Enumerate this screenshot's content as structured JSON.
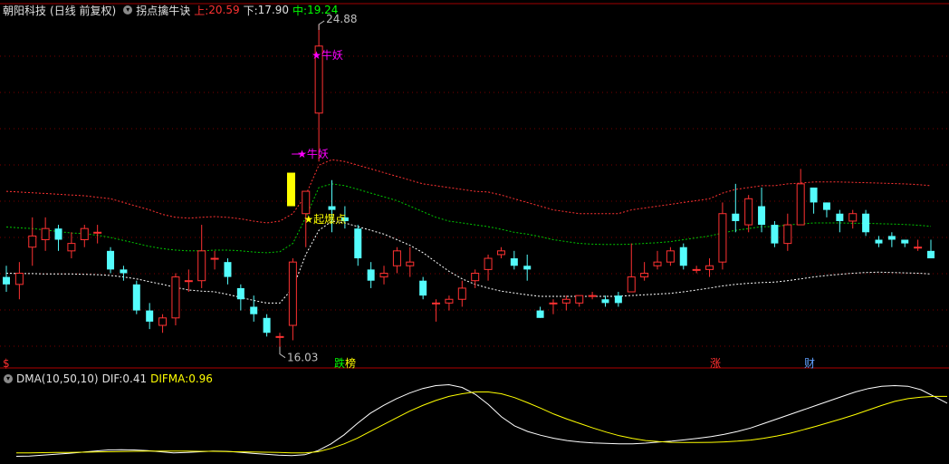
{
  "header": {
    "stock_name": "朝阳科技",
    "period": "(日线 前复权)",
    "indicator": "拐点擒牛诀",
    "upper_label": "上:",
    "upper_value": "20.59",
    "lower_label": "下:",
    "lower_value": "17.90",
    "mid_label": "中:",
    "mid_value": "19.24"
  },
  "annotations": {
    "high_price": "24.88",
    "low_price": "16.03",
    "star_top": "★牛妖",
    "star_mid": "★牛妖",
    "star_start": "★起爆点"
  },
  "events": [
    {
      "label": "$",
      "color": "#ff3030"
    },
    {
      "label": "跌",
      "color": "#00ff00"
    },
    {
      "label": "榜",
      "color": "#ffff00"
    },
    {
      "label": "涨",
      "color": "#ff3030"
    },
    {
      "label": "财",
      "color": "#60a0ff"
    }
  ],
  "sub_header": {
    "indicator": "DMA(10,50,10)",
    "dif_label": "DIF:",
    "dif_value": "0.41",
    "difma_label": "DIFMA:",
    "difma_value": "0.96"
  },
  "colors": {
    "up": "#ff3232",
    "down": "#54fcfc",
    "upper_band": "#ff3232",
    "mid_band": "#00c800",
    "lower_band": "#ffffff",
    "start_bar": "#ffff00",
    "star": "#ff00ff",
    "dif": "#ffffff",
    "difma": "#ffff00"
  },
  "chart_data": {
    "type": "candlestick",
    "price_range": [
      16.03,
      24.88
    ],
    "candles": [
      [
        18.1,
        17.9,
        18.4,
        17.7
      ],
      [
        17.9,
        18.2,
        18.5,
        17.5
      ],
      [
        18.9,
        19.2,
        19.7,
        18.4
      ],
      [
        19.1,
        19.4,
        19.7,
        18.8
      ],
      [
        19.4,
        19.1,
        19.5,
        18.8
      ],
      [
        18.8,
        19.0,
        19.3,
        18.6
      ],
      [
        19.1,
        19.4,
        19.5,
        18.9
      ],
      [
        19.3,
        19.3,
        19.5,
        19.0
      ],
      [
        18.8,
        18.3,
        18.9,
        18.2
      ],
      [
        18.3,
        18.2,
        18.4,
        18.0
      ],
      [
        17.9,
        17.2,
        18.0,
        17.1
      ],
      [
        17.2,
        16.9,
        17.4,
        16.7
      ],
      [
        16.8,
        17.0,
        17.1,
        16.6
      ],
      [
        17.0,
        18.1,
        18.2,
        16.8
      ],
      [
        18.0,
        18.0,
        18.3,
        17.7
      ],
      [
        18.0,
        18.8,
        19.5,
        17.8
      ],
      [
        18.6,
        18.6,
        18.8,
        18.3
      ],
      [
        18.5,
        18.1,
        18.6,
        17.9
      ],
      [
        17.8,
        17.5,
        17.9,
        17.2
      ],
      [
        17.3,
        17.1,
        17.6,
        16.9
      ],
      [
        17.0,
        16.6,
        17.1,
        16.5
      ],
      [
        16.5,
        16.5,
        16.6,
        16.03
      ],
      [
        16.8,
        18.5,
        18.6,
        16.4
      ],
      [
        19.8,
        20.4,
        20.4,
        18.9
      ],
      [
        22.5,
        24.3,
        24.88,
        21.2
      ],
      [
        20.0,
        19.9,
        20.7,
        19.3
      ],
      [
        19.7,
        19.6,
        20.0,
        19.4
      ],
      [
        19.4,
        18.6,
        19.5,
        18.4
      ],
      [
        18.3,
        18.0,
        18.5,
        17.8
      ],
      [
        18.1,
        18.2,
        18.4,
        17.9
      ],
      [
        18.4,
        18.8,
        18.9,
        18.2
      ],
      [
        18.4,
        18.5,
        18.9,
        18.1
      ],
      [
        18.0,
        17.6,
        18.1,
        17.5
      ],
      [
        17.4,
        17.4,
        17.5,
        16.9
      ],
      [
        17.4,
        17.5,
        17.6,
        17.2
      ],
      [
        17.5,
        17.8,
        18.0,
        17.3
      ],
      [
        18.0,
        18.2,
        18.3,
        17.8
      ],
      [
        18.3,
        18.6,
        18.7,
        18.0
      ],
      [
        18.7,
        18.8,
        18.9,
        18.6
      ],
      [
        18.6,
        18.4,
        18.8,
        18.3
      ],
      [
        18.4,
        18.3,
        18.7,
        18.0
      ],
      [
        17.2,
        17.0,
        17.3,
        17.0
      ],
      [
        17.4,
        17.4,
        17.5,
        17.1
      ],
      [
        17.4,
        17.5,
        17.6,
        17.2
      ],
      [
        17.4,
        17.6,
        17.6,
        17.3
      ],
      [
        17.6,
        17.6,
        17.7,
        17.5
      ],
      [
        17.5,
        17.4,
        17.6,
        17.3
      ],
      [
        17.6,
        17.4,
        17.7,
        17.3
      ],
      [
        17.7,
        18.1,
        19.0,
        17.7
      ],
      [
        18.1,
        18.2,
        18.5,
        18.0
      ],
      [
        18.4,
        18.5,
        18.8,
        18.3
      ],
      [
        18.5,
        18.8,
        18.9,
        18.4
      ],
      [
        18.9,
        18.4,
        19.0,
        18.3
      ],
      [
        18.3,
        18.3,
        18.4,
        18.2
      ],
      [
        18.3,
        18.4,
        18.6,
        18.1
      ],
      [
        18.5,
        19.8,
        20.1,
        18.3
      ],
      [
        19.8,
        19.6,
        20.6,
        19.3
      ],
      [
        19.5,
        20.2,
        20.3,
        19.3
      ],
      [
        20.0,
        19.5,
        20.5,
        19.3
      ],
      [
        19.5,
        19.0,
        19.6,
        18.9
      ],
      [
        19.0,
        19.5,
        19.8,
        18.8
      ],
      [
        19.5,
        20.6,
        21.0,
        19.5
      ],
      [
        20.5,
        20.1,
        20.5,
        19.8
      ],
      [
        20.1,
        19.9,
        20.1,
        19.7
      ],
      [
        19.8,
        19.6,
        19.9,
        19.3
      ],
      [
        19.6,
        19.8,
        19.9,
        19.4
      ],
      [
        19.8,
        19.3,
        19.9,
        19.2
      ],
      [
        19.1,
        19.0,
        19.2,
        18.9
      ],
      [
        19.2,
        19.1,
        19.3,
        18.9
      ],
      [
        19.1,
        19.0,
        19.1,
        18.9
      ],
      [
        18.9,
        18.9,
        19.1,
        18.8
      ],
      [
        18.8,
        18.6,
        19.1,
        18.6
      ]
    ],
    "bands": {
      "upper": [
        20.4,
        20.38,
        20.36,
        20.34,
        20.32,
        20.3,
        20.28,
        20.24,
        20.2,
        20.1,
        20.0,
        19.9,
        19.78,
        19.7,
        19.68,
        19.7,
        19.72,
        19.7,
        19.66,
        19.6,
        19.55,
        19.6,
        19.8,
        20.3,
        21.1,
        21.25,
        21.2,
        21.1,
        21.0,
        20.9,
        20.8,
        20.7,
        20.6,
        20.55,
        20.5,
        20.45,
        20.4,
        20.38,
        20.3,
        20.2,
        20.1,
        20.0,
        19.9,
        19.85,
        19.8,
        19.8,
        19.8,
        19.8,
        19.9,
        19.95,
        20.0,
        20.05,
        20.1,
        20.15,
        20.2,
        20.35,
        20.45,
        20.5,
        20.55,
        20.55,
        20.6,
        20.62,
        20.65,
        20.65,
        20.65,
        20.64,
        20.63,
        20.62,
        20.61,
        20.6,
        20.58,
        20.55
      ],
      "mid": [
        19.44,
        19.42,
        19.4,
        19.36,
        19.32,
        19.28,
        19.26,
        19.22,
        19.16,
        19.08,
        19.0,
        18.92,
        18.86,
        18.82,
        18.8,
        18.8,
        18.82,
        18.82,
        18.8,
        18.77,
        18.75,
        18.78,
        19.0,
        19.7,
        20.5,
        20.6,
        20.55,
        20.45,
        20.35,
        20.25,
        20.15,
        20.0,
        19.85,
        19.7,
        19.6,
        19.55,
        19.5,
        19.45,
        19.38,
        19.3,
        19.25,
        19.18,
        19.1,
        19.05,
        19.0,
        18.98,
        18.97,
        18.97,
        18.98,
        19.0,
        19.02,
        19.05,
        19.1,
        19.15,
        19.2,
        19.28,
        19.35,
        19.4,
        19.45,
        19.45,
        19.5,
        19.52,
        19.55,
        19.55,
        19.55,
        19.54,
        19.54,
        19.53,
        19.52,
        19.51,
        19.49,
        19.46
      ],
      "lower": [
        18.2,
        18.19,
        18.19,
        18.18,
        18.18,
        18.18,
        18.17,
        18.16,
        18.14,
        18.1,
        18.05,
        17.97,
        17.9,
        17.82,
        17.75,
        17.72,
        17.7,
        17.63,
        17.55,
        17.47,
        17.4,
        17.4,
        17.8,
        18.7,
        19.35,
        19.6,
        19.55,
        19.45,
        19.35,
        19.25,
        19.1,
        18.95,
        18.75,
        18.5,
        18.25,
        18.05,
        17.9,
        17.8,
        17.72,
        17.67,
        17.62,
        17.58,
        17.58,
        17.58,
        17.58,
        17.58,
        17.58,
        17.58,
        17.6,
        17.62,
        17.64,
        17.66,
        17.7,
        17.75,
        17.8,
        17.86,
        17.9,
        17.93,
        17.95,
        17.96,
        18.0,
        18.05,
        18.1,
        18.14,
        18.17,
        18.2,
        18.22,
        18.23,
        18.22,
        18.21,
        18.2,
        18.18
      ]
    },
    "dma": {
      "dif": [
        -0.75,
        -0.74,
        -0.7,
        -0.66,
        -0.62,
        -0.57,
        -0.52,
        -0.47,
        -0.46,
        -0.47,
        -0.5,
        -0.55,
        -0.6,
        -0.58,
        -0.55,
        -0.52,
        -0.53,
        -0.57,
        -0.62,
        -0.66,
        -0.7,
        -0.72,
        -0.68,
        -0.5,
        -0.2,
        0.2,
        0.7,
        1.15,
        1.5,
        1.8,
        2.05,
        2.25,
        2.38,
        2.42,
        2.3,
        2.0,
        1.55,
        1.0,
        0.6,
        0.35,
        0.18,
        0.05,
        -0.05,
        -0.12,
        -0.16,
        -0.18,
        -0.2,
        -0.2,
        -0.17,
        -0.12,
        -0.08,
        -0.02,
        0.05,
        0.12,
        0.22,
        0.35,
        0.5,
        0.7,
        0.9,
        1.1,
        1.3,
        1.5,
        1.7,
        1.9,
        2.1,
        2.25,
        2.35,
        2.38,
        2.35,
        2.2,
        1.9,
        1.6
      ],
      "difma": [
        -0.6,
        -0.6,
        -0.59,
        -0.58,
        -0.58,
        -0.57,
        -0.56,
        -0.55,
        -0.54,
        -0.53,
        -0.52,
        -0.52,
        -0.52,
        -0.52,
        -0.53,
        -0.53,
        -0.54,
        -0.55,
        -0.56,
        -0.57,
        -0.58,
        -0.6,
        -0.6,
        -0.55,
        -0.4,
        -0.2,
        0.05,
        0.35,
        0.65,
        0.95,
        1.25,
        1.5,
        1.72,
        1.9,
        2.02,
        2.1,
        2.1,
        2.02,
        1.85,
        1.62,
        1.38,
        1.12,
        0.9,
        0.7,
        0.5,
        0.32,
        0.16,
        0.04,
        -0.05,
        -0.1,
        -0.13,
        -0.14,
        -0.14,
        -0.13,
        -0.11,
        -0.08,
        -0.03,
        0.05,
        0.15,
        0.27,
        0.42,
        0.58,
        0.75,
        0.92,
        1.1,
        1.3,
        1.5,
        1.68,
        1.8,
        1.87,
        1.9,
        1.9
      ],
      "range": [
        -0.85,
        2.6
      ]
    }
  }
}
